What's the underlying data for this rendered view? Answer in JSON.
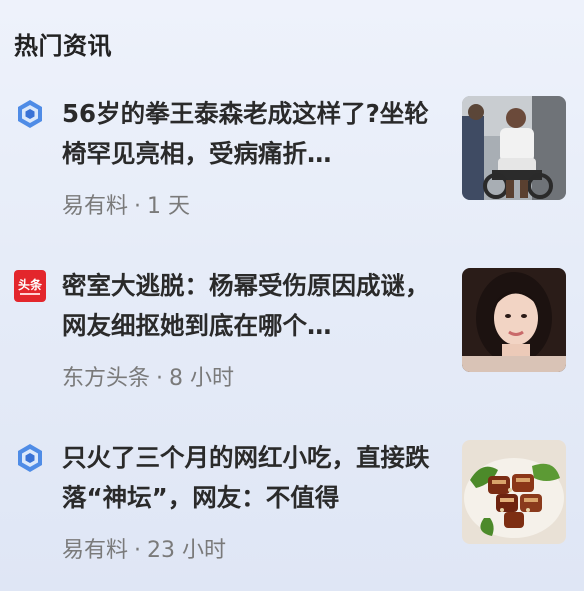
{
  "section": {
    "title": "热门资讯"
  },
  "news": [
    {
      "title": "56岁的拳王泰森老成这样了?坐轮椅罕见亮相，受病痛折…",
      "source": "易有料",
      "separator": "·",
      "time": "1 天",
      "source_icon": "hexagon-logo-icon",
      "thumb": "tyson-wheelchair-photo"
    },
    {
      "title": "密室大逃脱：杨幂受伤原因成谜，网友细抠她到底在哪个…",
      "source": "东方头条",
      "separator": "·",
      "time": "8 小时",
      "source_icon": "toutiao-red-logo-icon",
      "thumb": "yang-mi-portrait-photo"
    },
    {
      "title": "只火了三个月的网红小吃，直接跌落“神坛”，网友：不值得",
      "source": "易有料",
      "separator": "·",
      "time": "23 小时",
      "source_icon": "hexagon-logo-icon",
      "thumb": "braised-pork-dish-photo"
    }
  ],
  "logos": {
    "toutiao_text": "头条"
  },
  "colors": {
    "title_text": "#2a2a2a",
    "meta_text": "#7a7a7a",
    "hex_blue": "#3f7fe0",
    "toutiao_red": "#e3262c"
  }
}
